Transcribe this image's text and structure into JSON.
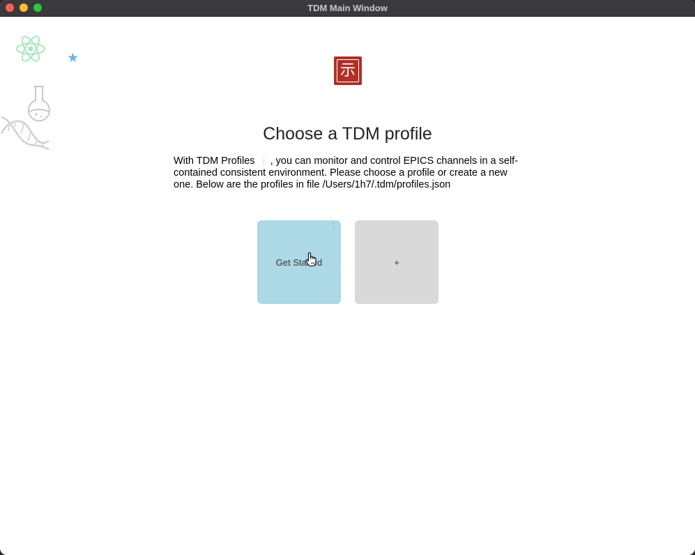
{
  "window": {
    "title": "TDM Main Window"
  },
  "decorations": [
    "atom-icon",
    "star-icon",
    "flask-icon",
    "dna-icon"
  ],
  "logo": {
    "glyph": "示",
    "color": "#b03026"
  },
  "heading": "Choose a TDM profile",
  "description": {
    "part1": "With TDM Profiles",
    "menu_glyph": "⋮",
    "part2": ", you can monitor and control EPICS channels in a self-contained consistent environment. Please choose a profile or create a new one. Below are the profiles in file /Users/1h7/.tdm/profiles.json"
  },
  "profiles": [
    {
      "label": "Get Started",
      "menu_glyph": "⋮",
      "color": "#add8e6"
    }
  ],
  "add_card": {
    "label": "+",
    "color": "#d9d9d9"
  }
}
